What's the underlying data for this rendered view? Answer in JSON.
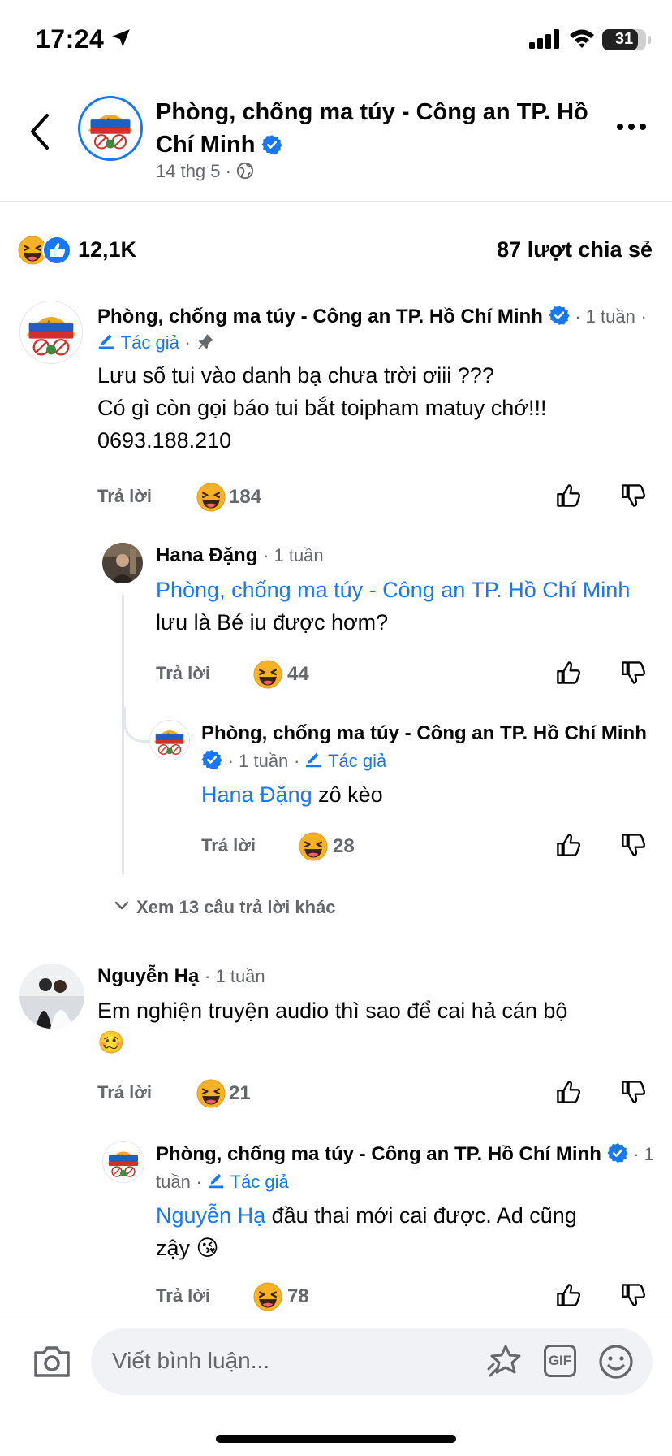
{
  "status_bar": {
    "time": "17:24",
    "battery": "31"
  },
  "header": {
    "page_name": "Phòng, chống ma túy - Công an TP. Hồ Chí Minh",
    "date": "14 thg 5",
    "logo_text_top": "VÌ TP HCM",
    "logo_text_bottom": "KHÔNG MA TÚY"
  },
  "summary": {
    "reaction_count": "12,1K",
    "shares": "87 lượt chia sẻ"
  },
  "comments": [
    {
      "author": "Phòng, chống ma túy - Công an TP. Hồ Chí Minh",
      "time": "1 tuần",
      "author_badge": "Tác giả",
      "pinned": true,
      "lines": [
        "Lưu số tui vào danh bạ chưa trời ơiii ???",
        "Có gì còn gọi báo tui bắt toipham matuy chớ!!!",
        "0693.188.210"
      ],
      "reply_label": "Trả lời",
      "reaction_count": "184",
      "replies": [
        {
          "author": "Hana Đặng",
          "time": "1 tuần",
          "mention": "Phòng, chống ma túy - Công an TP. Hồ Chí Minh",
          "text": "lưu là Bé iu được hơm?",
          "reply_label": "Trả lời",
          "reaction_count": "44"
        },
        {
          "author": "Phòng, chống ma túy - Công an TP. Hồ Chí Minh",
          "time": "1 tuần",
          "author_badge": "Tác giả",
          "mention": "Hana Đặng",
          "text": "zô kèo",
          "reply_label": "Trả lời",
          "reaction_count": "28"
        }
      ],
      "more_replies": "Xem 13 câu trả lời khác"
    },
    {
      "author": "Nguyễn Hạ",
      "time": "1 tuần",
      "text": "Em nghiện truyện audio thì sao để cai hả cán bộ",
      "emoji": "🥴",
      "reply_label": "Trả lời",
      "reaction_count": "21",
      "replies": [
        {
          "author": "Phòng, chống ma túy - Công an TP. Hồ Chí Minh",
          "time": "1 tuần",
          "author_badge": "Tác giả",
          "mention": "Nguyễn Hạ",
          "text": "đầu thai mới cai được. Ad cũng",
          "text2": "zậy",
          "emoji": "😘",
          "reply_label": "Trả lời",
          "reaction_count": "78"
        }
      ]
    }
  ],
  "composer": {
    "placeholder": "Viết bình luận...",
    "gif_label": "GIF"
  },
  "colors": {
    "accent": "#1877f2",
    "muted": "#65676b",
    "haha": "#f7b125"
  }
}
